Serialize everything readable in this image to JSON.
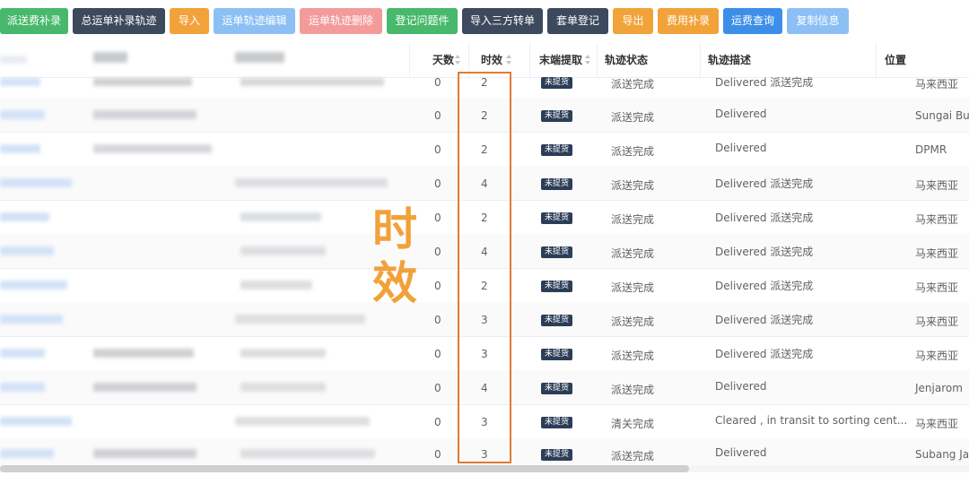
{
  "toolbar": {
    "buttons": [
      {
        "label": "派送费补录"
      },
      {
        "label": "总运单补录轨迹"
      },
      {
        "label": "导入"
      },
      {
        "label": "运单轨迹编辑"
      },
      {
        "label": "运单轨迹删除"
      },
      {
        "label": "登记问题件"
      },
      {
        "label": "导入三方转单"
      },
      {
        "label": "套单登记"
      },
      {
        "label": "导出"
      },
      {
        "label": "费用补录"
      },
      {
        "label": "运费查询"
      },
      {
        "label": "复制信息"
      }
    ]
  },
  "table": {
    "headers": {
      "days": "天数",
      "aging": "时效",
      "last_mile": "末端提取",
      "track_status": "轨迹状态",
      "track_desc": "轨迹描述",
      "location": "位置"
    },
    "rows": [
      {
        "days": "0",
        "aging": "2",
        "tag": "未提货",
        "status": "派送完成",
        "desc": "Delivered 派送完成",
        "location": "马来西亚"
      },
      {
        "days": "0",
        "aging": "2",
        "tag": "未提货",
        "status": "派送完成",
        "desc": "Delivered",
        "location": "Sungai Bul"
      },
      {
        "days": "0",
        "aging": "2",
        "tag": "未提货",
        "status": "派送完成",
        "desc": "Delivered",
        "location": "DPMR"
      },
      {
        "days": "0",
        "aging": "4",
        "tag": "未提货",
        "status": "派送完成",
        "desc": "Delivered 派送完成",
        "location": "马来西亚"
      },
      {
        "days": "0",
        "aging": "2",
        "tag": "未提货",
        "status": "派送完成",
        "desc": "Delivered 派送完成",
        "location": "马来西亚"
      },
      {
        "days": "0",
        "aging": "4",
        "tag": "未提货",
        "status": "派送完成",
        "desc": "Delivered 派送完成",
        "location": "马来西亚"
      },
      {
        "days": "0",
        "aging": "2",
        "tag": "未提货",
        "status": "派送完成",
        "desc": "Delivered 派送完成",
        "location": "马来西亚"
      },
      {
        "days": "0",
        "aging": "3",
        "tag": "未提货",
        "status": "派送完成",
        "desc": "Delivered 派送完成",
        "location": "马来西亚"
      },
      {
        "days": "0",
        "aging": "3",
        "tag": "未提货",
        "status": "派送完成",
        "desc": "Delivered 派送完成",
        "location": "马来西亚"
      },
      {
        "days": "0",
        "aging": "4",
        "tag": "未提货",
        "status": "派送完成",
        "desc": "Delivered",
        "location": "Jenjarom"
      },
      {
        "days": "0",
        "aging": "3",
        "tag": "未提货",
        "status": "清关完成",
        "desc": "Cleared , in transit to sorting cent...",
        "location": "马来西亚"
      },
      {
        "days": "0",
        "aging": "3",
        "tag": "未提货",
        "status": "派送完成",
        "desc": "Delivered",
        "location": "Subang Ja"
      }
    ]
  },
  "annotation": {
    "char1": "时",
    "char2": "效",
    "color": "#f2a13a",
    "box_color": "#e27b2f"
  }
}
